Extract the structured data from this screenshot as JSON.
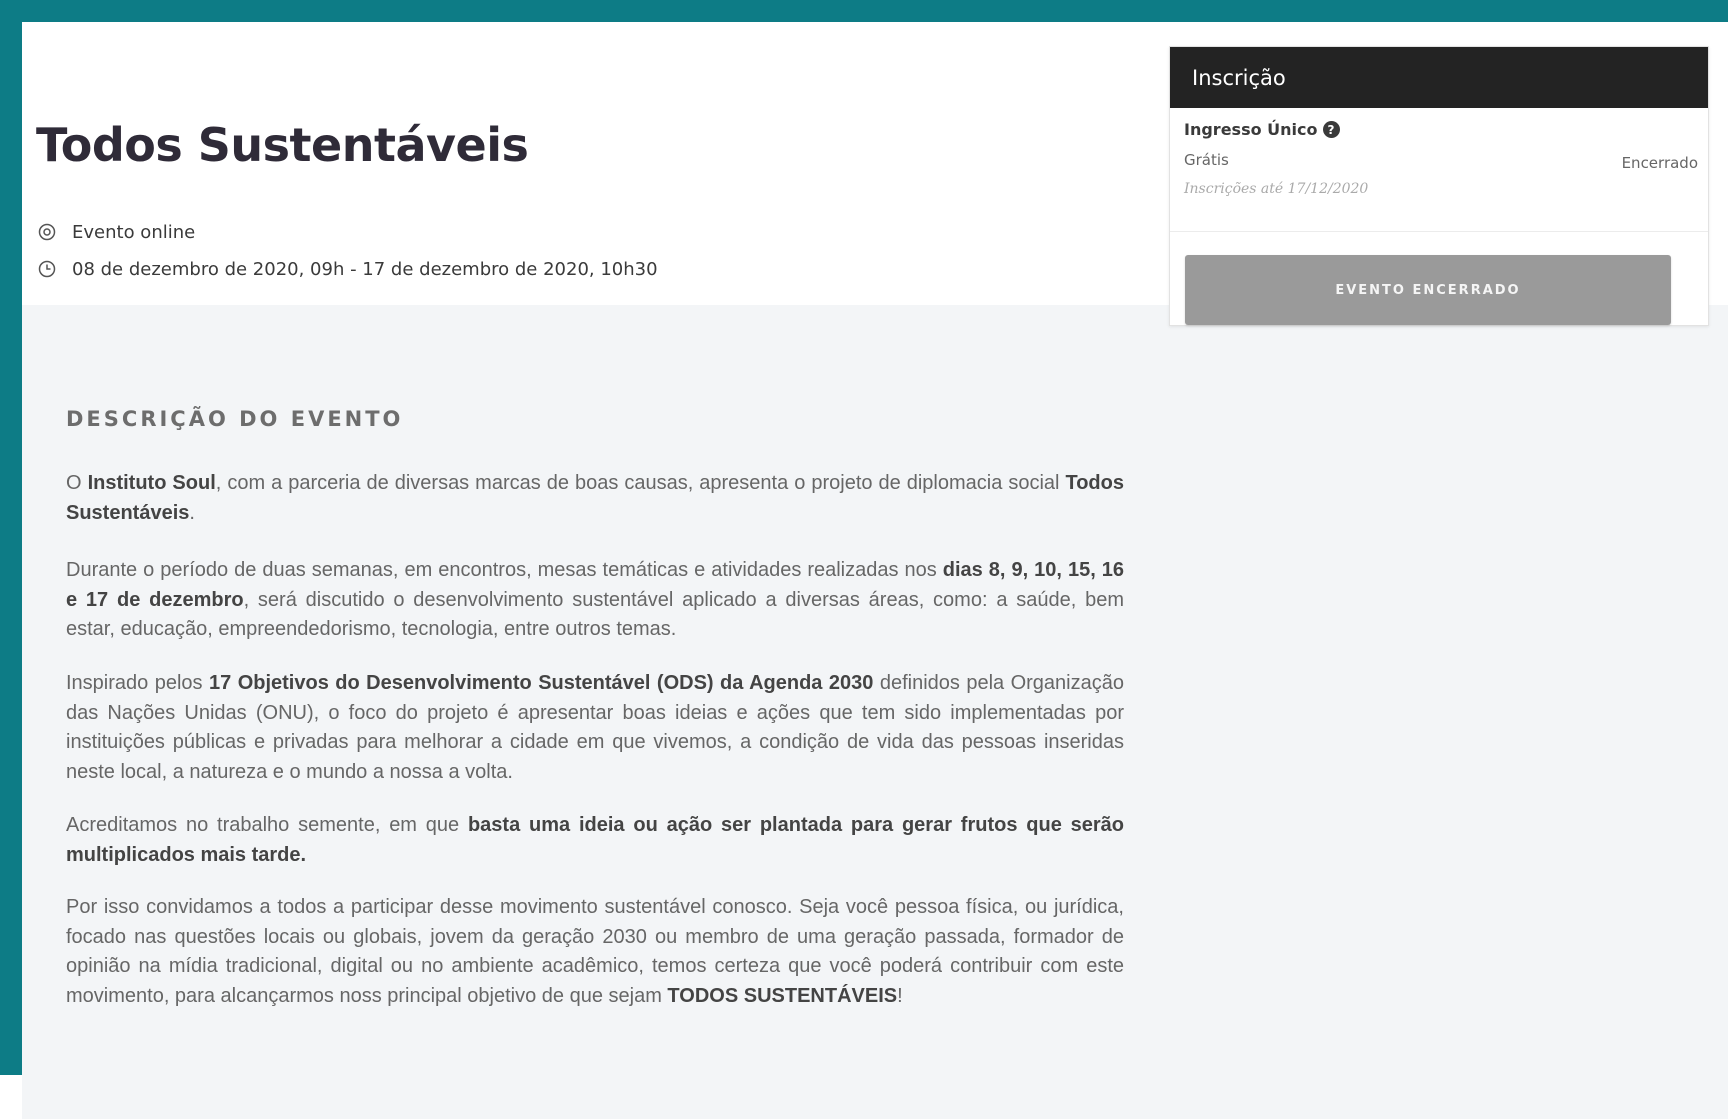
{
  "colors": {
    "frame": "#0d7c86",
    "title": "#2f2b38",
    "card_header": "#232323",
    "button": "#9a9a9a"
  },
  "event": {
    "title": "Todos Sustentáveis",
    "location": "Evento online",
    "dates": "08 de dezembro de 2020, 09h - 17 de dezembro de 2020, 10h30",
    "location_icon": "map-pin-icon",
    "date_icon": "clock-icon"
  },
  "registration": {
    "header": "Inscrição",
    "ticket_name": "Ingresso Único",
    "help_icon": "question-circle-icon",
    "price": "Grátis",
    "status": "Encerrado",
    "deadline": "Inscrições até 17/12/2020",
    "button_label": "EVENTO ENCERRADO"
  },
  "description": {
    "heading": "DESCRIÇÃO DO EVENTO",
    "p1": {
      "a": "O ",
      "b1": "Instituto Soul",
      "c": ", com a parceria de diversas marcas de boas causas, apresenta o projeto de diplomacia social ",
      "b2": "Todos Sustentáveis",
      "d": "."
    },
    "p2": {
      "a": "Durante o período de duas semanas, em encontros, mesas temáticas e atividades realizadas nos ",
      "b1": "dias 8, 9, 10, 15, 16 e 17 de dezembro",
      "c": ", será discutido o desenvolvimento sustentável aplicado a diversas áreas, como: a saúde, bem estar, educação, empreendedorismo, tecnologia, entre outros temas."
    },
    "p3": {
      "a": "Inspirado pelos ",
      "b1": "17 Objetivos do Desenvolvimento Sustentável (ODS) da Agenda 2030",
      "c": " definidos pela Organização das Nações Unidas (ONU), o foco do projeto é apresentar boas ideias e ações que tem sido implementadas por instituições públicas e privadas para melhorar a cidade em que vivemos, a condição de vida das pessoas inseridas neste local, a natureza e o mundo a nossa a volta."
    },
    "p4": {
      "a": "Acreditamos no trabalho semente, em que ",
      "b1": "basta uma ideia ou ação ser plantada para gerar frutos que serão multiplicados mais tarde."
    },
    "p5": {
      "a": "Por isso convidamos a todos a participar desse movimento sustentável conosco. Seja você pessoa física, ou jurídica, focado nas questões locais ou globais, jovem da geração 2030 ou membro de uma geração passada, formador de opinião na mídia tradicional, digital ou no ambiente acadêmico, temos certeza que você poderá contribuir com este movimento, para alcançarmos noss principal objetivo de que sejam ",
      "b1": "TODOS SUSTENTÁVEIS",
      "c": "!"
    }
  }
}
